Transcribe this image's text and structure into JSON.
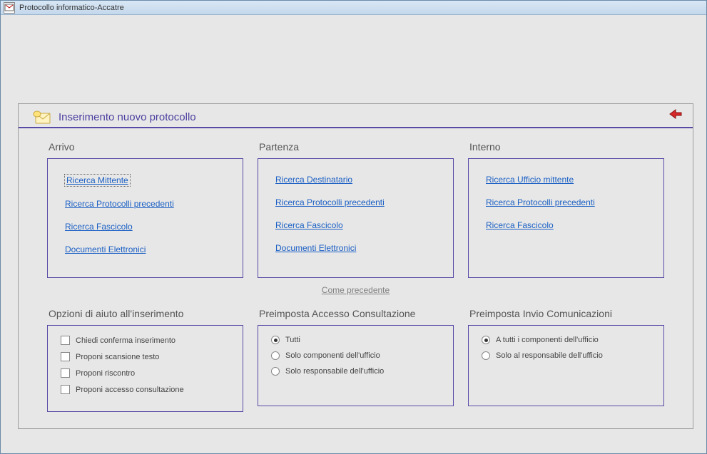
{
  "window": {
    "title": "Protocollo informatico-Accatre"
  },
  "card": {
    "heading": "Inserimento nuovo protocollo"
  },
  "sections": {
    "arrivo": {
      "title": "Arrivo",
      "links": {
        "ricercaMittente": "Ricerca Mittente",
        "ricercaProtocolliPrecedenti": "Ricerca Protocolli precedenti",
        "ricercaFascicolo": "Ricerca Fascicolo",
        "documentiElettronici": "Documenti Elettronici"
      }
    },
    "partenza": {
      "title": "Partenza",
      "links": {
        "ricercaDestinatario": "Ricerca Destinatario",
        "ricercaProtocolliPrecedenti": "Ricerca Protocolli precedenti",
        "ricercaFascicolo": "Ricerca Fascicolo",
        "documentiElettronici": "Documenti Elettronici"
      }
    },
    "interno": {
      "title": "Interno",
      "links": {
        "ricercaUfficioMittente": "Ricerca Ufficio mittente",
        "ricercaProtocolliPrecedenti": "Ricerca Protocolli precedenti",
        "ricercaFascicolo": "Ricerca Fascicolo"
      }
    }
  },
  "comePrecedente": "Come precedente",
  "opzioni": {
    "title": "Opzioni di aiuto all'inserimento",
    "items": {
      "chiediConferma": "Chiedi conferma inserimento",
      "proponiScansione": "Proponi scansione testo",
      "proponiRiscontro": "Proponi riscontro",
      "proponiAccesso": "Proponi accesso consultazione"
    }
  },
  "preAccesso": {
    "title": "Preimposta Accesso Consultazione",
    "options": {
      "tutti": "Tutti",
      "soloComponenti": "Solo componenti dell'ufficio",
      "soloResponsabile": "Solo responsabile dell'ufficio"
    },
    "selected": "tutti"
  },
  "preInvio": {
    "title": "Preimposta Invio Comunicazioni",
    "options": {
      "aTutti": "A tutti i componenti dell'ufficio",
      "soloResponsabile": "Solo al responsabile dell'ufficio"
    },
    "selected": "aTutti"
  }
}
